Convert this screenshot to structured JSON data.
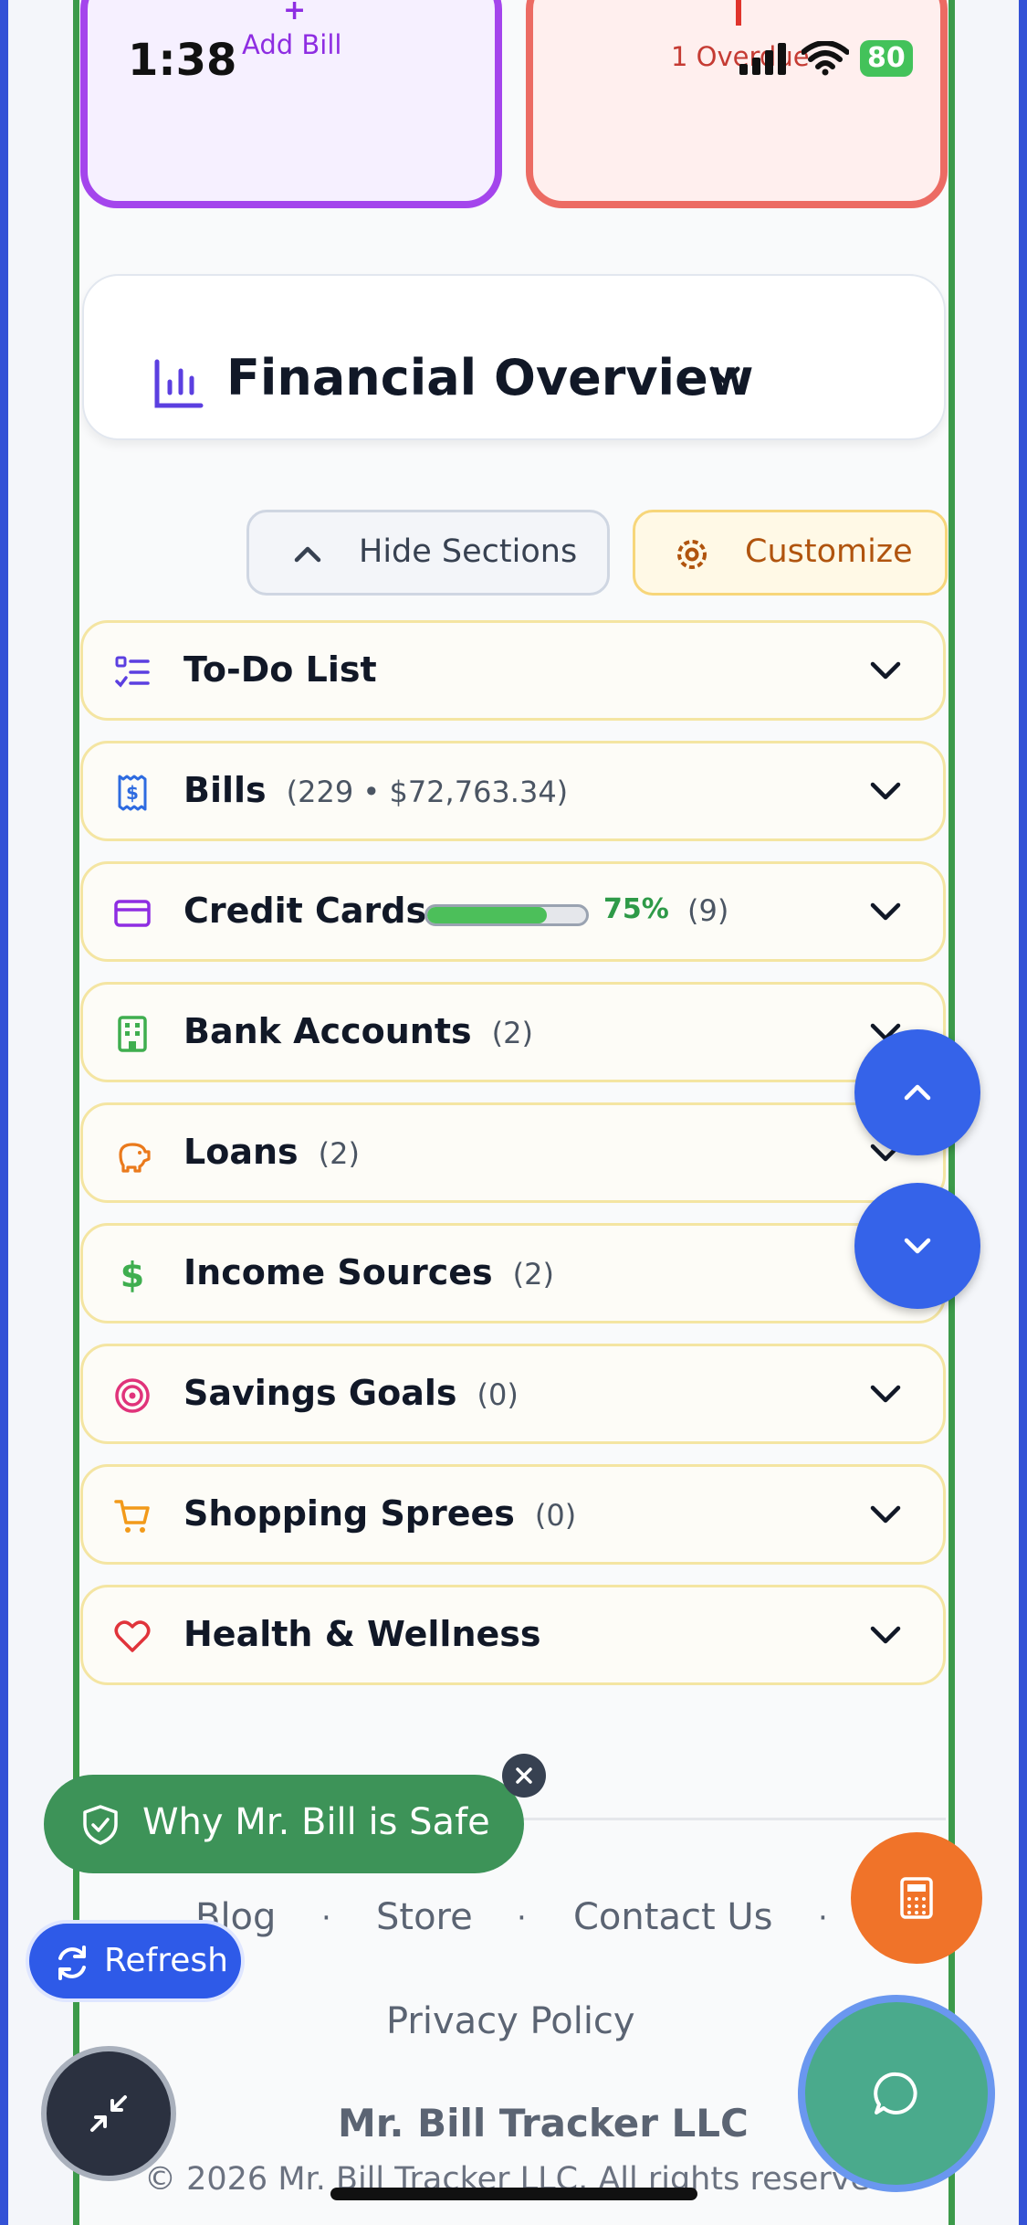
{
  "status_bar": {
    "time": "1:38",
    "battery": "80"
  },
  "cards": {
    "add_bill_plus": "+",
    "add_bill_label": "Add Bill",
    "overdue_label": "1 Overdue"
  },
  "overview": {
    "title": "Financial Overview"
  },
  "controls": {
    "hide_label": "Hide Sections",
    "customize_label": "Customize"
  },
  "sections": [
    {
      "label": "To-Do List",
      "count": ""
    },
    {
      "label": "Bills",
      "count": "(229 • $72,763.34)"
    },
    {
      "label": "Credit Cards",
      "percent": "75%",
      "progress": 0.75,
      "count": "(9)"
    },
    {
      "label": "Bank Accounts",
      "count": "(2)"
    },
    {
      "label": "Loans",
      "count": "(2)"
    },
    {
      "label": "Income Sources",
      "count": "(2)"
    },
    {
      "label": "Savings Goals",
      "count": "(0)"
    },
    {
      "label": "Shopping Sprees",
      "count": "(0)"
    },
    {
      "label": "Health & Wellness",
      "count": ""
    }
  ],
  "badges": {
    "safe_label": "Why Mr. Bill is Safe",
    "refresh_label": "Refresh"
  },
  "footer": {
    "links": [
      "Blog",
      "Store",
      "Contact Us",
      "Privacy Policy"
    ],
    "separator": "·",
    "company": "Mr. Bill Tracker LLC",
    "copyright": "© 2026 Mr. Bill Tracker LLC. All rights reserved."
  },
  "colors": {
    "accent": "#3563e9",
    "frame": "#3c9a4a",
    "safe": "#3d9358",
    "calc": "#f07329",
    "progress": "#4cbf5a"
  }
}
